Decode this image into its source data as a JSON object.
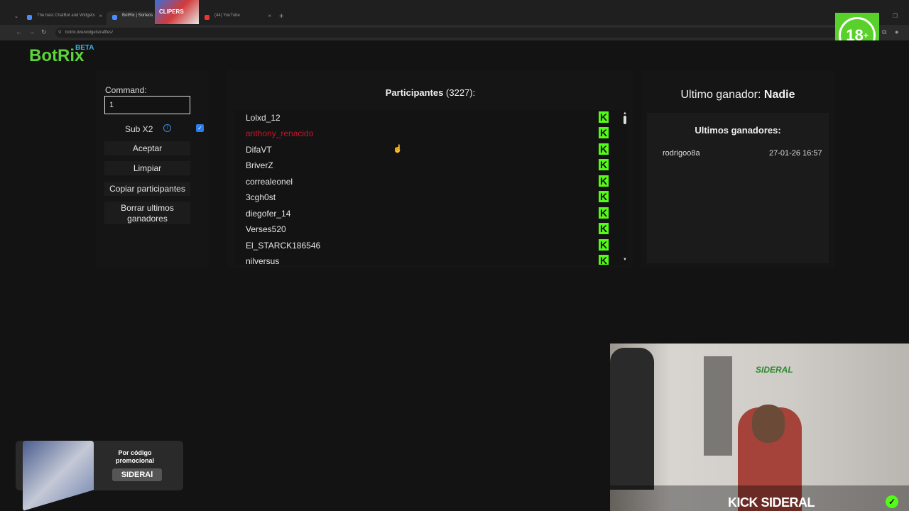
{
  "browser": {
    "tabs": [
      {
        "label": "The best ChatBot and Widgets"
      },
      {
        "label": "BotRix | Sorteos"
      },
      {
        "label": "(44) YouTube"
      }
    ],
    "url": "botrix.live/widgets/raffles/",
    "thumbnail_text": "CLIPERS"
  },
  "overlay": {
    "age_badge": "18",
    "promo_line1": "Por código promocional",
    "promo_code": "SIDERAl",
    "stream_tag_prefix": "KICK",
    "stream_tag_name": "SIDERAL",
    "cam_logo": "SIDERAL"
  },
  "app": {
    "logo": "BotRix",
    "logo_badge": "BETA",
    "command_label": "Command:",
    "command_value": "1",
    "sub_label": "Sub X2",
    "buttons": {
      "accept": "Aceptar",
      "clear": "Limpiar",
      "copy": "Copiar participantes",
      "delete_winners": "Borrar ultimos ganadores"
    },
    "participants_title": "Participantes",
    "participants_count": "(3227):",
    "participants": [
      {
        "name": "Lolxd_12",
        "highlight": false
      },
      {
        "name": "anthony_renacido",
        "highlight": true
      },
      {
        "name": "DifaVT",
        "highlight": false
      },
      {
        "name": "BriverZ",
        "highlight": false
      },
      {
        "name": "correaleonel",
        "highlight": false
      },
      {
        "name": "3cgh0st",
        "highlight": false
      },
      {
        "name": "diegofer_14",
        "highlight": false
      },
      {
        "name": "Verses520",
        "highlight": false
      },
      {
        "name": "El_STARCK186546",
        "highlight": false
      },
      {
        "name": "nilversus",
        "highlight": false
      }
    ],
    "platform_letter": "K",
    "last_winner_label": "Ultimo ganador:",
    "last_winner_value": "Nadie",
    "winners_title": "Ultimos ganadores:",
    "winners": [
      {
        "name": "rodrigoo8a",
        "date": "27-01-26 16:57"
      }
    ]
  },
  "colors": {
    "kick_green": "#53fc18",
    "brand_green": "#5cd43a",
    "highlight_red": "#c5162c"
  }
}
